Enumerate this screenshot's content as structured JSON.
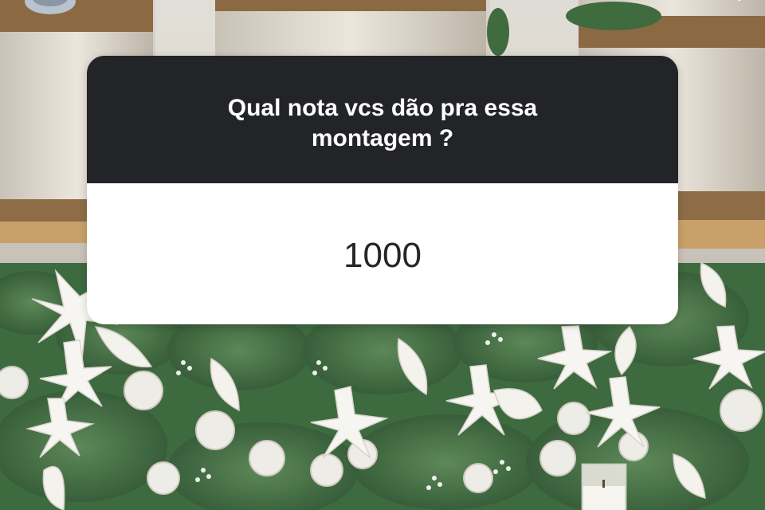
{
  "question_sticker": {
    "question": "Qual nota vcs dão pra essa montagem ?",
    "answer": "1000"
  },
  "colors": {
    "header_bg": "#232427",
    "answer_bg": "#ffffff",
    "answer_text": "#262626",
    "header_text": "#ffffff"
  },
  "icons": [
    "close-icon",
    "avatar"
  ]
}
